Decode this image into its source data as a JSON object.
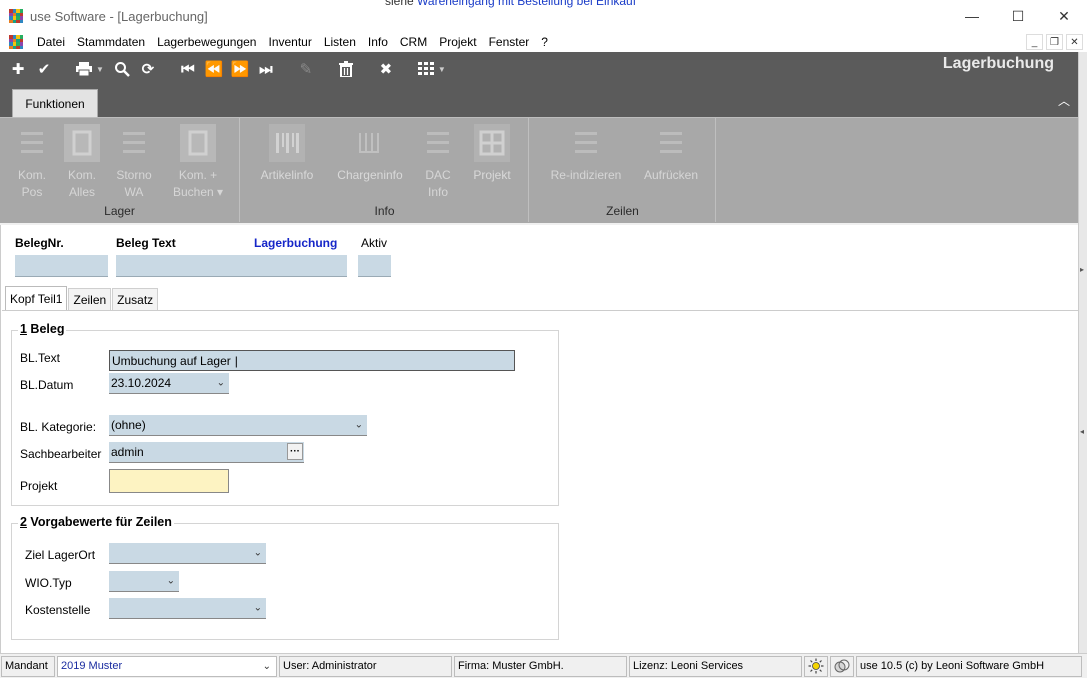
{
  "window": {
    "title": "use Software - [Lagerbuchung]",
    "bleed_text_prefix": "siehe ",
    "bleed_text_link": "Wareneingang mit Bestellung bei Einkauf"
  },
  "menu": [
    "Datei",
    "Stammdaten",
    "Lagerbewegungen",
    "Inventur",
    "Listen",
    "Info",
    "CRM",
    "Projekt",
    "Fenster",
    "?"
  ],
  "toolbar": {
    "heading": "Lagerbuchung"
  },
  "ribbon": {
    "tab": "Funktionen",
    "groups": [
      {
        "label": "Lager",
        "buttons": [
          "Kom.\nPos",
          "Kom.\nAlles",
          "Storno\nWA",
          "Kom. +\nBuchen ▾"
        ]
      },
      {
        "label": "Info",
        "buttons": [
          "Artikelinfo",
          "Chargeninfo",
          "DAC\nInfo",
          "Projekt"
        ]
      },
      {
        "label": "Zeilen",
        "buttons": [
          "Re-indizieren",
          "Aufrücken"
        ]
      }
    ]
  },
  "header": {
    "beleg_nr_label": "BelegNr.",
    "beleg_text_label": "Beleg Text",
    "lagerbuchung_label": "Lagerbuchung",
    "aktiv_label": "Aktiv",
    "beleg_nr_value": "",
    "beleg_text_value": ""
  },
  "tabs": [
    "Kopf Teil1",
    "Zeilen",
    "Zusatz"
  ],
  "group1": {
    "num": "1",
    "title": " Beleg",
    "bl_text_label": "BL.Text",
    "bl_text_value": "Umbuchung auf Lager",
    "bl_datum_label": "BL.Datum",
    "bl_datum_value": "23.10.2024",
    "kategorie_label": "BL. Kategorie:",
    "kategorie_value": "(ohne)",
    "sachbearbeiter_label": "Sachbearbeiter",
    "sachbearbeiter_value": "admin",
    "projekt_label": "Projekt",
    "projekt_value": ""
  },
  "group2": {
    "num": "2",
    "title": " Vorgabewerte für Zeilen",
    "ziel_label": "Ziel LagerOrt",
    "wio_label": "WIO.Typ",
    "kosten_label": "Kostenstelle"
  },
  "status": {
    "mandant_label": "Mandant",
    "mandant_value": "2019 Muster",
    "user": "User: Administrator",
    "firma": "Firma: Muster GmbH.",
    "lizenz": "Lizenz: Leoni Services",
    "version": "use 10.5 (c) by Leoni Software GmbH"
  },
  "colors": {
    "toolbar_bg": "#5b5b5b",
    "ribbon_bg": "#a8a8a8",
    "field_bg": "#c9d9e4",
    "projekt_bg": "#fdf3c2",
    "accent_blue": "#1626c8"
  }
}
